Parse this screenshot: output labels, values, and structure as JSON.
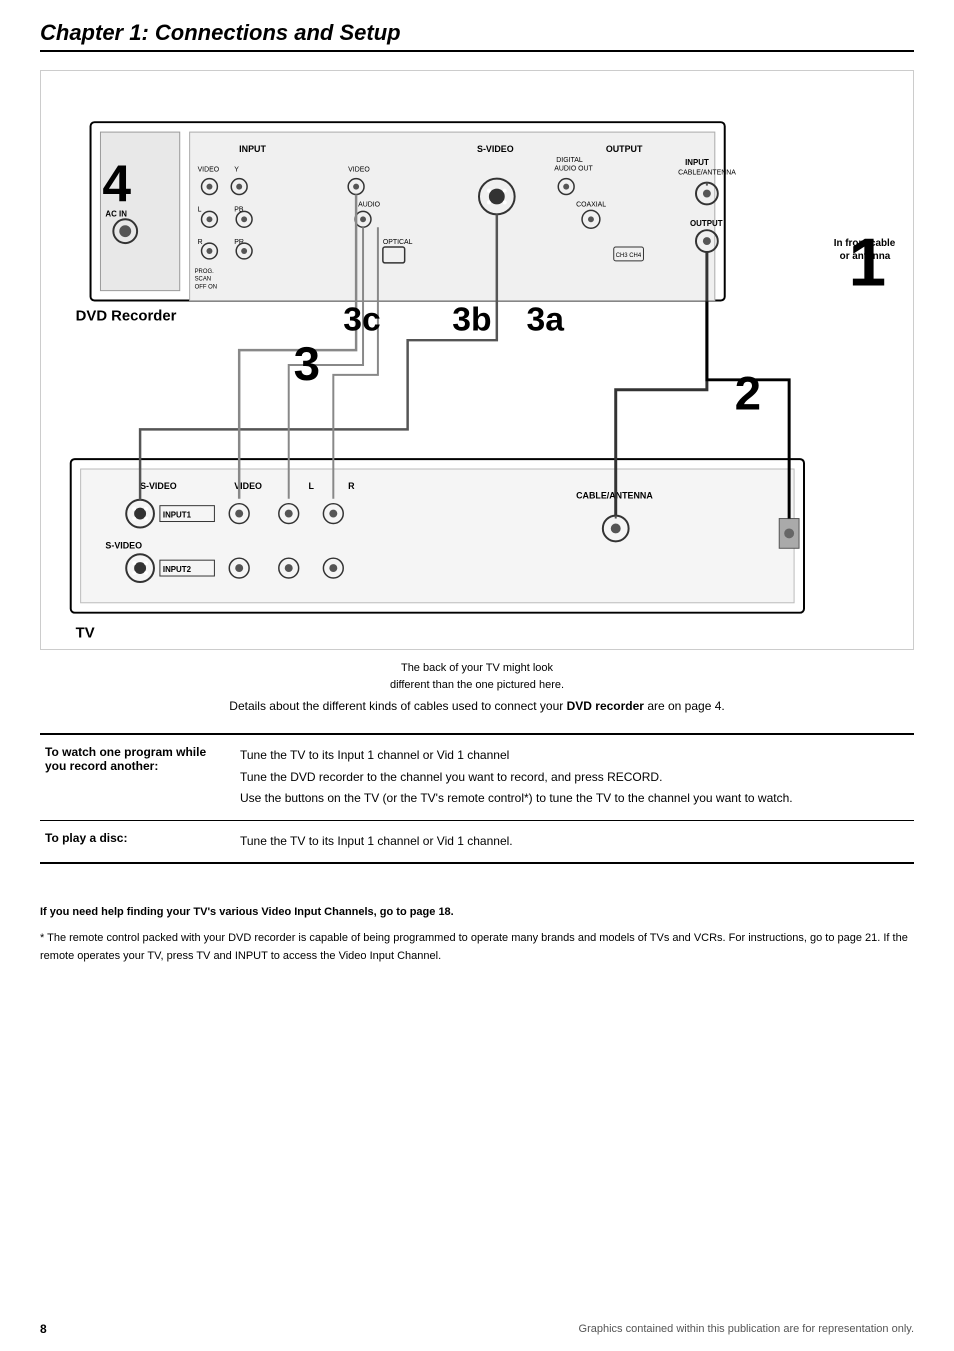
{
  "page": {
    "chapter_title": "Chapter 1: Connections and Setup",
    "page_number": "8",
    "footer_caption": "Graphics contained within this publication are for representation only."
  },
  "labels": {
    "dvd_recorder": "DVD Recorder",
    "tv": "TV",
    "step1": "1",
    "step2": "2",
    "step3": "3",
    "step3a": "3a",
    "step3b": "3b",
    "step3c": "3c",
    "step4": "4",
    "cable_antenna_line1": "In from cable",
    "cable_antenna_line2": "or antenna",
    "diagram_note_line1": "The back of your TV might look",
    "diagram_note_line2": "different than the one pictured here.",
    "details_line_prefix": "Details about the different kinds of cables used to connect your ",
    "details_line_bold": "DVD recorder",
    "details_line_suffix": " are on page 4.",
    "connector_svideo": "S-VIDEO",
    "connector_video": "VIDEO",
    "connector_l": "L",
    "connector_r": "R",
    "connector_input1": "INPUT1",
    "connector_input2": "INPUT2",
    "connector_svideo2": "S-VIDEO",
    "cable_antenna_conn": "CABLE/ANTENNA",
    "ac_in": "AC IN"
  },
  "info_rows": [
    {
      "label": "To watch one program while\nyou record another:",
      "lines": [
        "Tune the TV to its Input 1 channel or Vid 1 channel",
        "Tune the DVD recorder to the channel you want to record, and press RECORD.",
        "Use the buttons on the TV (or the TV's remote control*) to tune the TV to the channel you want to watch."
      ]
    },
    {
      "label": "To play a disc:",
      "lines": [
        "Tune the TV to its Input 1 channel or Vid 1 channel."
      ]
    }
  ],
  "footer_notes": [
    {
      "bold": true,
      "text": "If you need help finding your TV's various Video Input Channels, go to page 18."
    },
    {
      "bold": false,
      "text": "* The remote control packed with your DVD recorder is capable of being programmed to operate many brands and models of TVs and VCRs. For instructions, go to page 21. If the remote operates your TV, press TV and INPUT to access the Video Input Channel."
    }
  ]
}
